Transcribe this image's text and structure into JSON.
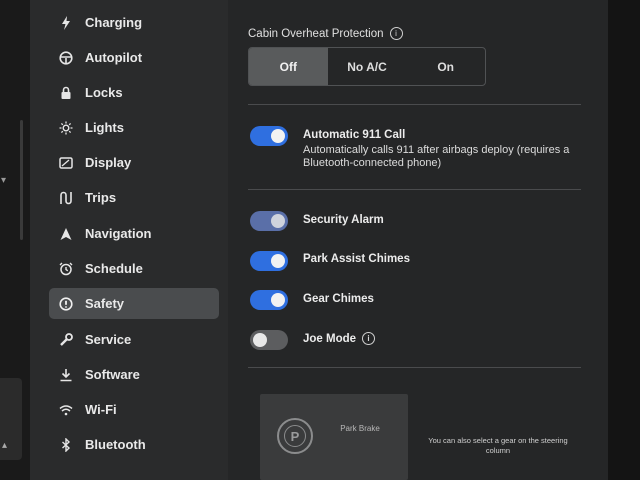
{
  "sidebar": {
    "items": [
      {
        "label": "Charging",
        "icon": "lightning-icon",
        "active": false
      },
      {
        "label": "Autopilot",
        "icon": "steering-wheel-icon",
        "active": false
      },
      {
        "label": "Locks",
        "icon": "lock-icon",
        "active": false
      },
      {
        "label": "Lights",
        "icon": "sun-icon",
        "active": false
      },
      {
        "label": "Display",
        "icon": "display-icon",
        "active": false
      },
      {
        "label": "Trips",
        "icon": "trips-icon",
        "active": false
      },
      {
        "label": "Navigation",
        "icon": "navigation-arrow-icon",
        "active": false
      },
      {
        "label": "Schedule",
        "icon": "alarm-clock-icon",
        "active": false
      },
      {
        "label": "Safety",
        "icon": "safety-alert-icon",
        "active": true
      },
      {
        "label": "Service",
        "icon": "wrench-icon",
        "active": false
      },
      {
        "label": "Software",
        "icon": "download-icon",
        "active": false
      },
      {
        "label": "Wi-Fi",
        "icon": "wifi-icon",
        "active": false
      },
      {
        "label": "Bluetooth",
        "icon": "bluetooth-icon",
        "active": false
      }
    ]
  },
  "cabin": {
    "title": "Cabin Overheat Protection",
    "options": [
      "Off",
      "No A/C",
      "On"
    ],
    "selected": "Off"
  },
  "settings": {
    "auto911": {
      "label": "Automatic 911 Call",
      "description": "Automatically calls 911 after airbags deploy (requires a Bluetooth-connected phone)",
      "state": "on"
    },
    "security_alarm": {
      "label": "Security Alarm",
      "state": "on-disabled"
    },
    "park_assist": {
      "label": "Park Assist Chimes",
      "state": "on"
    },
    "gear_chimes": {
      "label": "Gear Chimes",
      "state": "on"
    },
    "joe_mode": {
      "label": "Joe Mode",
      "state": "off"
    }
  },
  "drive": {
    "park_label": "Park Brake",
    "park_icon": "park-brake-icon",
    "note": "You can also select a gear on the steering column"
  },
  "colors": {
    "toggle_on": "#2f6fe0",
    "toggle_dim": "#5a6fa8",
    "toggle_off": "#5c5d5f",
    "active_nav": "#4a4c4e"
  }
}
